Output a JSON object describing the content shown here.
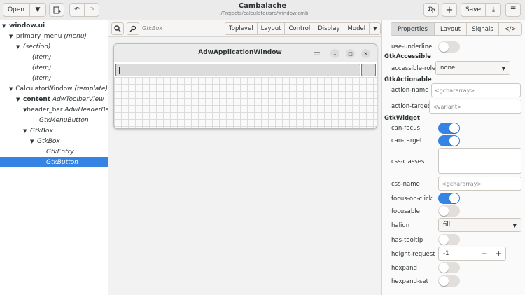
{
  "app": {
    "title": "Cambalache",
    "subtitle": "~/Projects/calculator/src/window.cmb"
  },
  "header": {
    "open_label": "Open",
    "open_dropdown_icon": "chevron-down-icon",
    "save_label": "Save"
  },
  "tree": {
    "rows": [
      {
        "name": "window.ui",
        "type": ""
      },
      {
        "name": "primary_menu",
        "type": "(menu)"
      },
      {
        "name": "(section)",
        "type": ""
      },
      {
        "name": "(item)",
        "type": ""
      },
      {
        "name": "(item)",
        "type": ""
      },
      {
        "name": "(item)",
        "type": ""
      },
      {
        "name": "CalculatorWindow",
        "type": "(template)"
      },
      {
        "name": "content",
        "type": "AdwToolbarView"
      },
      {
        "name": "header_bar",
        "type": "AdwHeaderBar"
      },
      {
        "name": "GtkMenuButton",
        "type": ""
      },
      {
        "name": "GtkBox",
        "type": ""
      },
      {
        "name": "GtkBox",
        "type": ""
      },
      {
        "name": "GtkEntry",
        "type": ""
      },
      {
        "name": "GtkButton",
        "type": ""
      }
    ]
  },
  "canvas": {
    "selection_label": "GtkBox",
    "segments": [
      "Toplevel",
      "Layout",
      "Control",
      "Display",
      "Model"
    ],
    "window_title": "AdwApplicationWindow"
  },
  "props": {
    "tabs": [
      "Properties",
      "Layout",
      "Signals",
      "</>"
    ],
    "use_underline": "use-underline",
    "sec_accessible": "GtkAccessible",
    "accessible_role": "accessible-role",
    "accessible_role_value": "none",
    "sec_actionable": "GtkActionable",
    "action_name": "action-name",
    "action_name_ph": "<gchararray>",
    "action_target": "action-target",
    "action_target_ph": "<variant>",
    "sec_widget": "GtkWidget",
    "can_focus": "can-focus",
    "can_target": "can-target",
    "css_classes": "css-classes",
    "css_name": "css-name",
    "css_name_ph": "<gchararray>",
    "focus_on_click": "focus-on-click",
    "focusable": "focusable",
    "halign": "halign",
    "halign_value": "fill",
    "has_tooltip": "has-tooltip",
    "height_request": "height-request",
    "height_request_value": "-1",
    "hexpand": "hexpand",
    "hexpand_set": "hexpand-set"
  },
  "toggles": {
    "use_underline": false,
    "can_focus": true,
    "can_target": true,
    "focus_on_click": true,
    "focusable": false,
    "has_tooltip": false,
    "hexpand": false,
    "hexpand_set": false
  },
  "colors": {
    "accent": "#3584e4",
    "selection": "#3584e4"
  }
}
